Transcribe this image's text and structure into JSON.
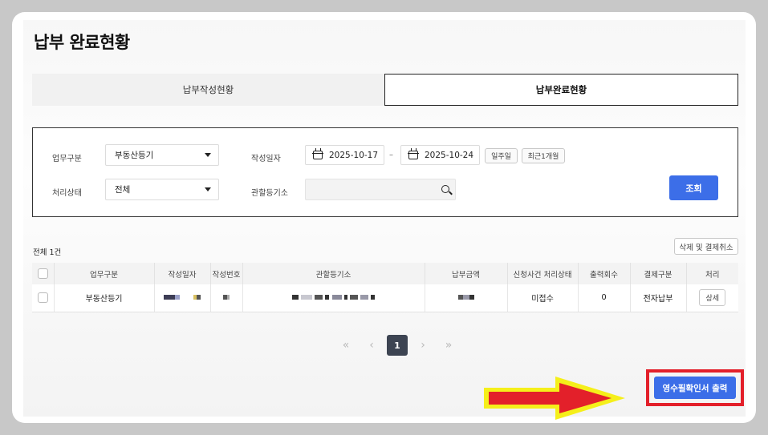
{
  "page": {
    "title": "납부 완료현황"
  },
  "tabs": [
    {
      "label": "납부작성현황",
      "active": false
    },
    {
      "label": "납부완료현황",
      "active": true
    }
  ],
  "filters": {
    "business_type_label": "업무구분",
    "business_type_value": "부동산등기",
    "status_label": "처리상태",
    "status_value": "전체",
    "date_label": "작성일자",
    "date_from": "2025-10-17",
    "date_sep": "–",
    "date_to": "2025-10-24",
    "quick_week": "일주일",
    "quick_month": "최근1개월",
    "registry_label": "관할등기소",
    "registry_value": "",
    "search_button": "조회"
  },
  "results": {
    "total": "전체 1건",
    "delete_button": "삭제 및 결제취소",
    "columns": [
      "업무구분",
      "작성일자",
      "작성번호",
      "관할등기소",
      "납부금액",
      "신청사건 처리상태",
      "출력회수",
      "결제구분",
      "처리"
    ],
    "rows": [
      {
        "business_type": "부동산등기",
        "status": "미접수",
        "print_count": "0",
        "payment_type": "전자납부",
        "action": "상세"
      }
    ]
  },
  "pagination": {
    "first": "«",
    "prev": "‹",
    "current": "1",
    "next": "›",
    "last": "»"
  },
  "footer": {
    "print_button": "영수필확인서 출력"
  },
  "colors": {
    "primary": "#3c6ee8",
    "highlight_red": "#e3202a",
    "arrow_fill": "#e3202a",
    "arrow_outline": "#f5ef1a"
  }
}
